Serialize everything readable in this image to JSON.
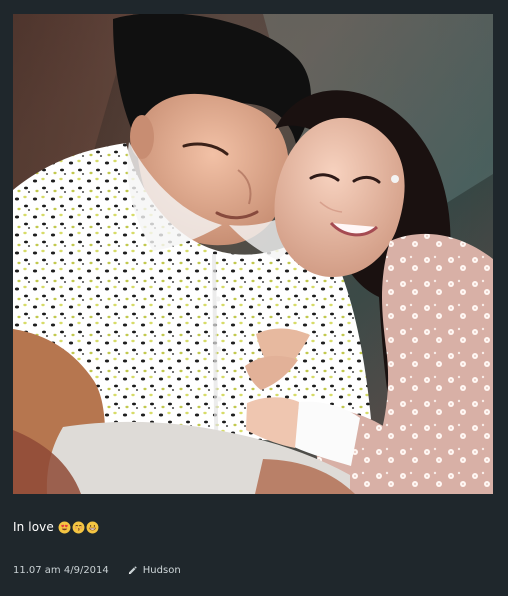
{
  "post": {
    "caption": "In love",
    "emoji": [
      "heart-eyes-face",
      "kissing-face",
      "grinning-face"
    ],
    "timestamp": "11.07 am 4/9/2014",
    "author": "Hudson"
  },
  "colors": {
    "background": "#1f272c",
    "caption_text": "#ffffff",
    "meta_text": "#c9d1d4",
    "emoji_yellow": "#f4c542"
  },
  "icons": {
    "edit": "pencil-icon"
  }
}
